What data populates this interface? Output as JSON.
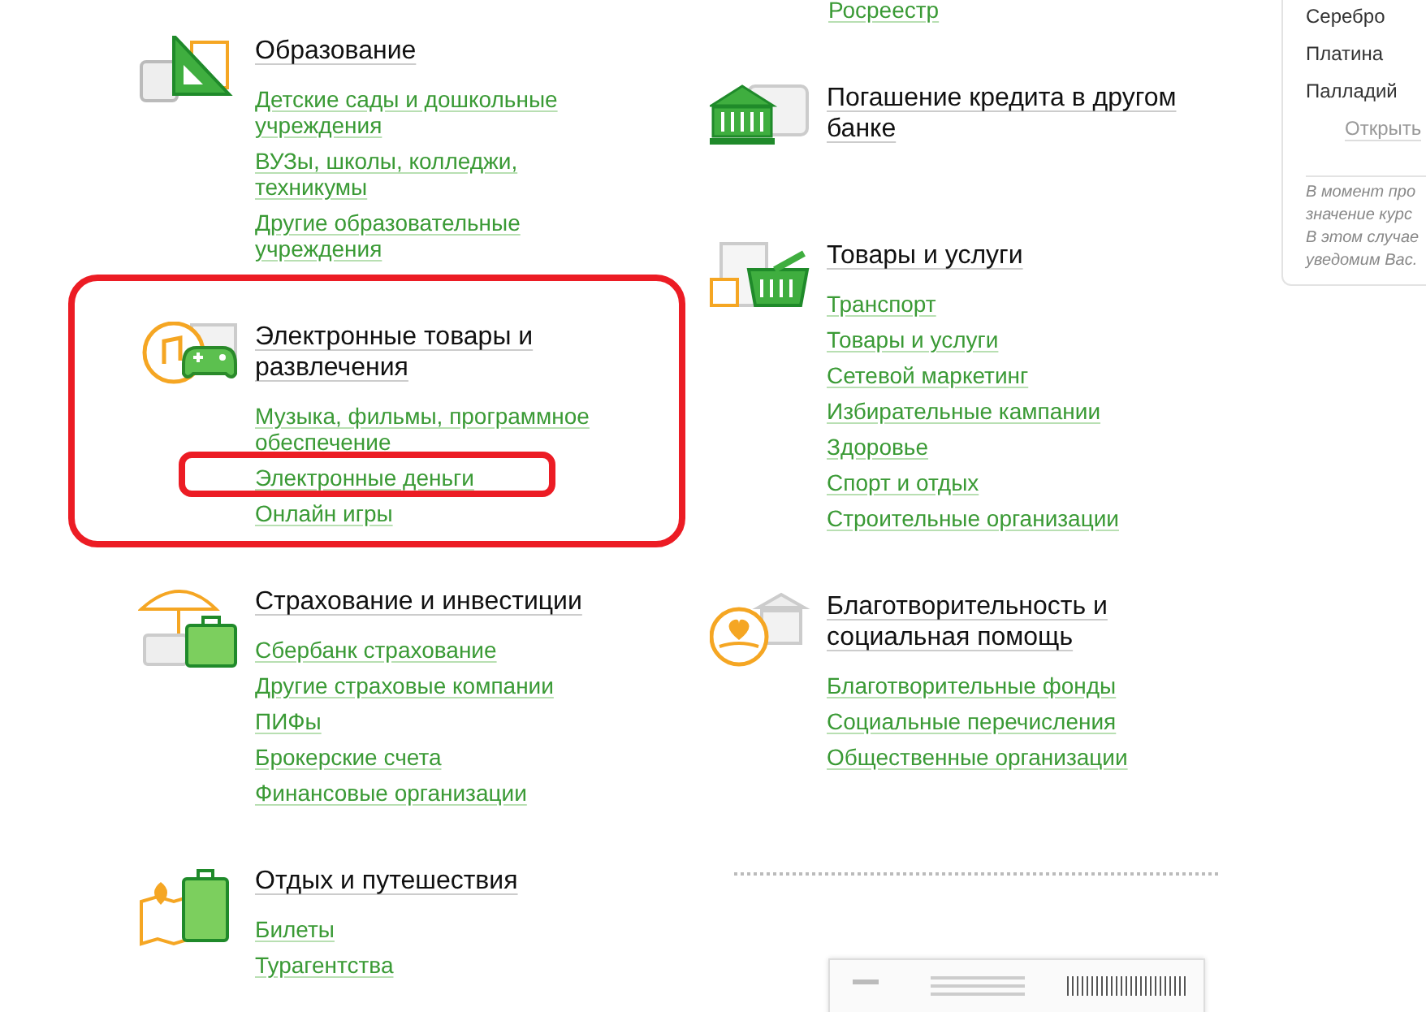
{
  "left_column": {
    "sections": [
      {
        "title": "Образование",
        "highlighted": false,
        "links": [
          {
            "label": "Детские сады и дошкольные учреждения",
            "highlighted": false
          },
          {
            "label": "ВУЗы, школы, колледжи, техникумы",
            "highlighted": false
          },
          {
            "label": "Другие образовательные учреждения",
            "highlighted": false
          }
        ]
      },
      {
        "title": "Электронные товары и развлечения",
        "highlighted": true,
        "links": [
          {
            "label": "Музыка, фильмы, программное обеспечение",
            "highlighted": false
          },
          {
            "label": "Электронные деньги",
            "highlighted": true
          },
          {
            "label": "Онлайн игры",
            "highlighted": false
          }
        ]
      },
      {
        "title": "Страхование и инвестиции",
        "highlighted": false,
        "links": [
          {
            "label": "Сбербанк страхование",
            "highlighted": false
          },
          {
            "label": "Другие страховые компании",
            "highlighted": false
          },
          {
            "label": "ПИФы",
            "highlighted": false
          },
          {
            "label": "Брокерские счета",
            "highlighted": false
          },
          {
            "label": "Финансовые организации",
            "highlighted": false
          }
        ]
      },
      {
        "title": "Отдых и путешествия",
        "highlighted": false,
        "links": [
          {
            "label": "Билеты",
            "highlighted": false
          },
          {
            "label": "Турагентства",
            "highlighted": false
          }
        ]
      }
    ]
  },
  "middle_column": {
    "top_link": "Росреестр",
    "sections": [
      {
        "title": "Погашение кредита в другом банке",
        "highlighted": false
      },
      {
        "title": "Товары и услуги",
        "highlighted": false,
        "links": [
          {
            "label": "Транспорт",
            "highlighted": false
          },
          {
            "label": "Товары и услуги",
            "highlighted": false
          },
          {
            "label": "Сетевой маркетинг",
            "highlighted": false
          },
          {
            "label": "Избирательные кампании",
            "highlighted": false
          },
          {
            "label": "Здоровье",
            "highlighted": false
          },
          {
            "label": "Спорт и отдых",
            "highlighted": false
          },
          {
            "label": "Строительные организации",
            "highlighted": false
          }
        ]
      },
      {
        "title": "Благотворительность и социальная помощь",
        "highlighted": false,
        "links": [
          {
            "label": "Благотворительные фонды",
            "highlighted": false
          },
          {
            "label": "Социальные перечисления",
            "highlighted": false
          },
          {
            "label": "Общественные организации",
            "highlighted": false
          }
        ]
      }
    ]
  },
  "rates_panel": {
    "metals": [
      "Серебро",
      "Платина",
      "Палладий"
    ],
    "open_link": "Открыть",
    "note_lines": [
      "В момент про",
      "значение курс",
      "В этом случае",
      "уведомим Вас."
    ]
  }
}
